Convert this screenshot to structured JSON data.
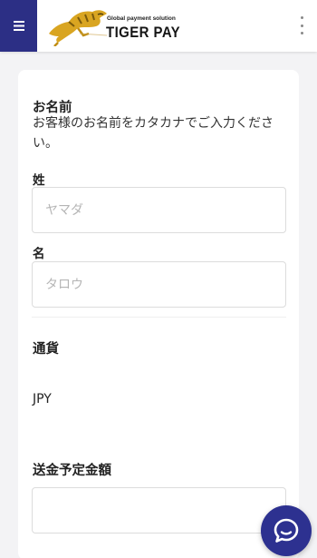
{
  "header": {
    "menu_icon": "hamburger-menu-icon",
    "logo_tagline": "Global payment solution",
    "logo_name": "TIGER PAY",
    "more_icon": "more-vertical-icon"
  },
  "form": {
    "name_section": {
      "title": "お名前",
      "description": "お客様のお名前をカタカナでご入力ください。"
    },
    "last_name": {
      "label": "姓",
      "placeholder": "ヤマダ",
      "value": ""
    },
    "first_name": {
      "label": "名",
      "placeholder": "タロウ",
      "value": ""
    },
    "currency": {
      "label": "通貨",
      "value": "JPY"
    },
    "amount": {
      "label": "送金予定金額",
      "placeholder": "",
      "value": ""
    }
  },
  "chat": {
    "icon": "chat-bubble-icon"
  },
  "colors": {
    "primary": "#2c2f85",
    "background": "#f3f3f5",
    "logo_gold": "#d9a521"
  }
}
